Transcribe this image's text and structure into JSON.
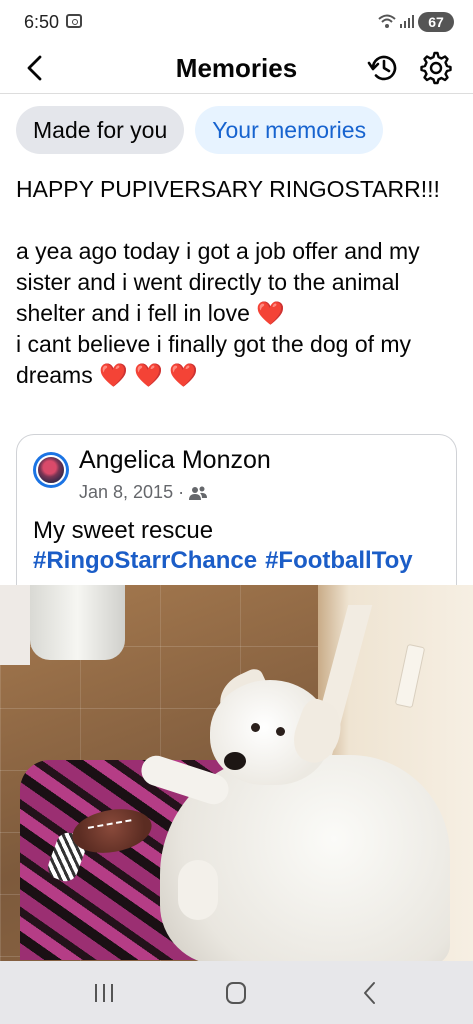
{
  "status_bar": {
    "time": "6:50",
    "battery": "67"
  },
  "header": {
    "title": "Memories"
  },
  "tabs": [
    {
      "label": "Made for you",
      "active": true
    },
    {
      "label": "Your memories",
      "active": false
    }
  ],
  "post": {
    "text": "HAPPY PUPIVERSARY RINGOSTARR!!!\n\na yea ago today i got a job offer and my sister and i went directly to the animal shelter and i fell in love ❤️\ni cant believe i finally got the dog of my dreams ❤️ ❤️ ❤️"
  },
  "shared_post": {
    "author": "Angelica Monzon",
    "date": "Jan 8, 2015 ·",
    "audience_icon": "friends-icon",
    "caption": "My sweet rescue",
    "hashtags": [
      "#RingoStarrChance",
      "#FootballToy"
    ]
  },
  "colors": {
    "accent": "#1763cf",
    "hashtag": "#1b5dc7",
    "tab_active_bg": "#e4e6eb",
    "tab_inactive_bg": "#e7f3ff",
    "nav_bar_bg": "#e7e7ea"
  },
  "nav_bar": {
    "buttons": [
      "recents-icon",
      "home-icon",
      "back-icon"
    ]
  }
}
